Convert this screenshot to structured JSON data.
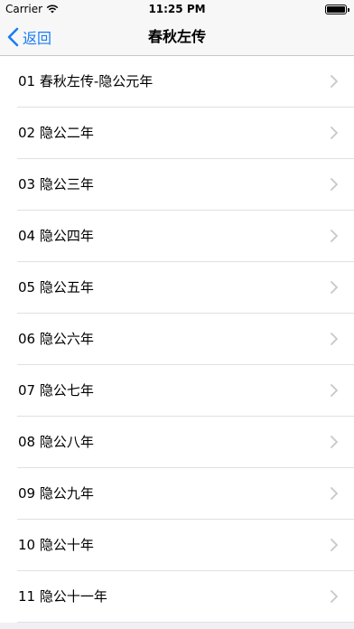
{
  "status_bar": {
    "carrier": "Carrier",
    "time": "11:25 PM",
    "wifi_icon": "wifi-icon",
    "battery_icon": "battery-icon"
  },
  "nav": {
    "back_label": "返回",
    "back_icon": "chevron-left-icon",
    "title": "春秋左传",
    "accent_color": "#1a7cf9"
  },
  "list": {
    "items": [
      {
        "label": "01 春秋左传-隐公元年"
      },
      {
        "label": "02 隐公二年"
      },
      {
        "label": "03 隐公三年"
      },
      {
        "label": "04 隐公四年"
      },
      {
        "label": "05 隐公五年"
      },
      {
        "label": "06 隐公六年"
      },
      {
        "label": "07 隐公七年"
      },
      {
        "label": "08 隐公八年"
      },
      {
        "label": "09 隐公九年"
      },
      {
        "label": "10 隐公十年"
      },
      {
        "label": "11 隐公十一年"
      }
    ],
    "disclosure_icon": "chevron-right-icon"
  }
}
